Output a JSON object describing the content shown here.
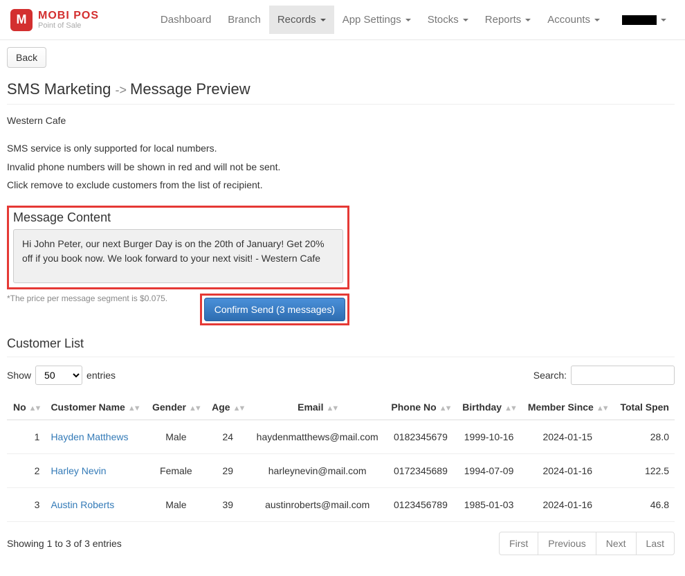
{
  "brand": {
    "main": "MOBI POS",
    "sub": "Point of Sale"
  },
  "nav": {
    "dashboard": "Dashboard",
    "branch": "Branch",
    "records": "Records",
    "app_settings": "App Settings",
    "stocks": "Stocks",
    "reports": "Reports",
    "accounts": "Accounts"
  },
  "back_label": "Back",
  "breadcrumb": {
    "root": "SMS Marketing",
    "leaf": "Message Preview"
  },
  "cafe_name": "Western Cafe",
  "notice_line1": "SMS service is only supported for local numbers.",
  "notice_line2": "Invalid phone numbers will be shown in red and will not be sent.",
  "notice_line3": "Click remove to exclude customers from the list of recipient.",
  "message_section": {
    "title": "Message Content",
    "body": "Hi John Peter, our next Burger Day is on the 20th of January! Get 20% off if you book now. We look forward to your next visit! - Western Cafe",
    "price_note": "*The price per message segment is $0.075.",
    "confirm_label": "Confirm Send (3 messages)"
  },
  "customer_list": {
    "title": "Customer List",
    "show_label": "Show",
    "entries_label": "entries",
    "page_size": "50",
    "search_label": "Search:",
    "columns": {
      "no": "No",
      "name": "Customer Name",
      "gender": "Gender",
      "age": "Age",
      "email": "Email",
      "phone": "Phone No",
      "birthday": "Birthday",
      "member_since": "Member Since",
      "total_spent": "Total Spen"
    },
    "rows": [
      {
        "no": "1",
        "name": "Hayden Matthews",
        "gender": "Male",
        "age": "24",
        "email": "haydenmatthews@mail.com",
        "phone": "0182345679",
        "birthday": "1999-10-16",
        "member_since": "2024-01-15",
        "total_spent": "28.0"
      },
      {
        "no": "2",
        "name": "Harley Nevin",
        "gender": "Female",
        "age": "29",
        "email": "harleynevin@mail.com",
        "phone": "0172345689",
        "birthday": "1994-07-09",
        "member_since": "2024-01-16",
        "total_spent": "122.5"
      },
      {
        "no": "3",
        "name": "Austin Roberts",
        "gender": "Male",
        "age": "39",
        "email": "austinroberts@mail.com",
        "phone": "0123456789",
        "birthday": "1985-01-03",
        "member_since": "2024-01-16",
        "total_spent": "46.8"
      }
    ],
    "footer_info": "Showing 1 to 3 of 3 entries",
    "pagination": {
      "first": "First",
      "previous": "Previous",
      "next": "Next",
      "last": "Last"
    }
  }
}
